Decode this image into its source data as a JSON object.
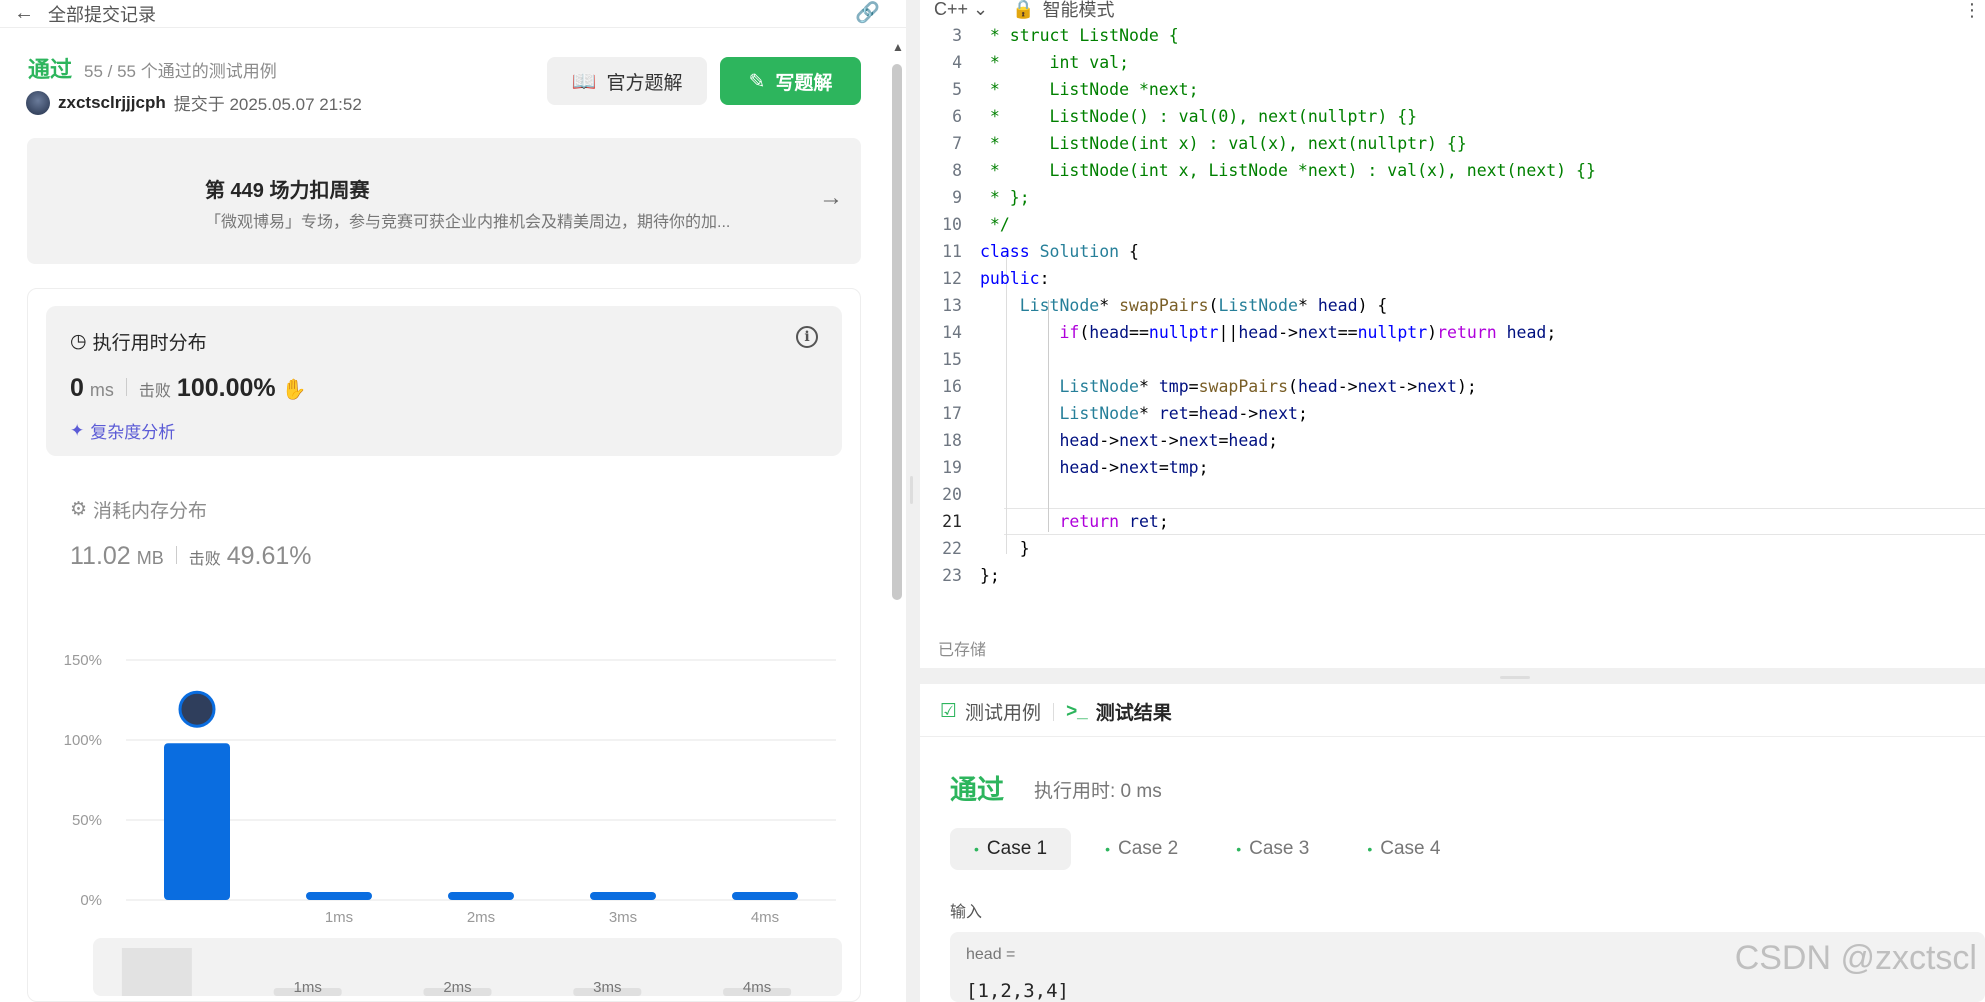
{
  "header": {
    "back_label": "全部提交记录"
  },
  "submission": {
    "status": "通过",
    "testcases": "55 / 55 个通过的测试用例",
    "user": "zxctsclrjjjcph",
    "submitted": "提交于 2025.05.07 21:52",
    "official_solution": "官方题解",
    "write_solution": "写题解"
  },
  "contest": {
    "title": "第 449 场力扣周赛",
    "subtitle": "「微观博易」专场，参与竞赛可获企业内推机会及精美周边，期待你的加..."
  },
  "runtime": {
    "title": "执行用时分布",
    "value": "0",
    "unit": "ms",
    "beat_label": "击败",
    "beat": "100.00%",
    "analysis": "复杂度分析"
  },
  "memory": {
    "title": "消耗内存分布",
    "value": "11.02",
    "unit": "MB",
    "beat_label": "击败",
    "beat": "49.61%"
  },
  "chart_data": {
    "type": "bar",
    "categories": [
      "",
      "1ms",
      "2ms",
      "3ms",
      "4ms"
    ],
    "values": [
      98,
      3,
      3,
      3,
      3
    ],
    "yticks": [
      "150%",
      "100%",
      "50%",
      "0%"
    ],
    "ylim": [
      0,
      150
    ],
    "bar_color": "#0a6de0",
    "grid": true
  },
  "minimap_labels": [
    "1ms",
    "2ms",
    "3ms",
    "4ms"
  ],
  "editor": {
    "language": "C++",
    "mode": "智能模式",
    "saved": "已存储",
    "lines": [
      {
        "n": "3",
        "t": " * struct ListNode {"
      },
      {
        "n": "4",
        "t": " *     int val;"
      },
      {
        "n": "5",
        "t": " *     ListNode *next;"
      },
      {
        "n": "6",
        "t": " *     ListNode() : val(0), next(nullptr) {}"
      },
      {
        "n": "7",
        "t": " *     ListNode(int x) : val(x), next(nullptr) {}"
      },
      {
        "n": "8",
        "t": " *     ListNode(int x, ListNode *next) : val(x), next(next) {}"
      },
      {
        "n": "9",
        "t": " * };"
      },
      {
        "n": "10",
        "t": " */"
      },
      {
        "n": "11",
        "t": "class Solution {"
      },
      {
        "n": "12",
        "t": "public:"
      },
      {
        "n": "13",
        "t": "    ListNode* swapPairs(ListNode* head) {"
      },
      {
        "n": "14",
        "t": "        if(head==nullptr||head->next==nullptr)return head;"
      },
      {
        "n": "15",
        "t": ""
      },
      {
        "n": "16",
        "t": "        ListNode* tmp=swapPairs(head->next->next);"
      },
      {
        "n": "17",
        "t": "        ListNode* ret=head->next;"
      },
      {
        "n": "18",
        "t": "        head->next->next=head;"
      },
      {
        "n": "19",
        "t": "        head->next=tmp;"
      },
      {
        "n": "20",
        "t": ""
      },
      {
        "n": "21",
        "t": "        return ret;"
      },
      {
        "n": "22",
        "t": "    }"
      },
      {
        "n": "23",
        "t": "};"
      }
    ]
  },
  "result": {
    "tab_testcase": "测试用例",
    "tab_result": "测试结果",
    "status": "通过",
    "runtime": "执行用时: 0 ms",
    "cases": [
      "Case 1",
      "Case 2",
      "Case 3",
      "Case 4"
    ],
    "input_label": "输入",
    "input_name": "head =",
    "input_value": "[1,2,3,4]"
  },
  "watermark": "CSDN @zxctscl"
}
